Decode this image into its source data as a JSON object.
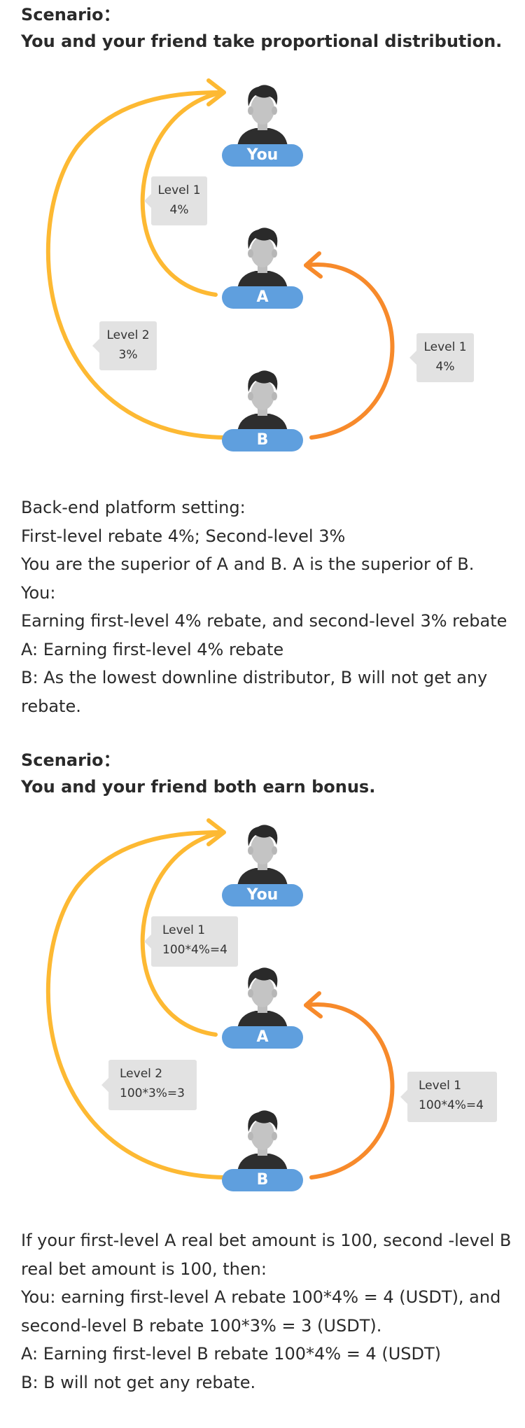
{
  "section1": {
    "heading_line1": "Scenario：",
    "heading_line2": "You and your friend take proportional distribution.",
    "diagram": {
      "you_label": "You",
      "a_label": "A",
      "b_label": "B",
      "tag_level1_you": {
        "line1": "Level 1",
        "line2": "4%"
      },
      "tag_level2": {
        "line1": "Level 2",
        "line2": "3%"
      },
      "tag_level1_a": {
        "line1": "Level 1",
        "line2": "4%"
      }
    },
    "lines": [
      "Back-end platform setting:",
      "First-level rebate 4%; Second-level 3%",
      "You are the superior of A and B. A is the superior of B.",
      "You:",
      "Earning first-level 4% rebate, and second-level 3% rebate",
      "A:  Earning first-level 4% rebate",
      "B:  As the lowest downline distributor, B will not get any",
      "rebate."
    ]
  },
  "section2": {
    "heading_line1": "Scenario：",
    "heading_line2": "You and your friend both earn bonus.",
    "diagram": {
      "you_label": "You",
      "a_label": "A",
      "b_label": "B",
      "tag_level1_you": {
        "line1": "Level 1",
        "line2": "100*4%=4"
      },
      "tag_level2": {
        "line1": "Level 2",
        "line2": "100*3%=3"
      },
      "tag_level1_a": {
        "line1": "Level 1",
        "line2": "100*4%=4"
      }
    },
    "lines": [
      "If your first-level A real bet amount is 100, second -level B",
      "real bet amount is 100, then:",
      "You: earning first-level A rebate 100*4% = 4 (USDT), and",
      "second-level B rebate 100*3% = 3 (USDT).",
      "A: Earning first-level B rebate 100*4% = 4 (USDT)",
      "B: B will not get any rebate."
    ]
  },
  "colors": {
    "yellow_arrow": "#fdb933",
    "orange_arrow": "#f78a2b",
    "pill": "#5f9fde",
    "tag_bg": "#e2e2e2"
  },
  "icons": [
    "person-avatar-icon",
    "arrow-icon"
  ]
}
